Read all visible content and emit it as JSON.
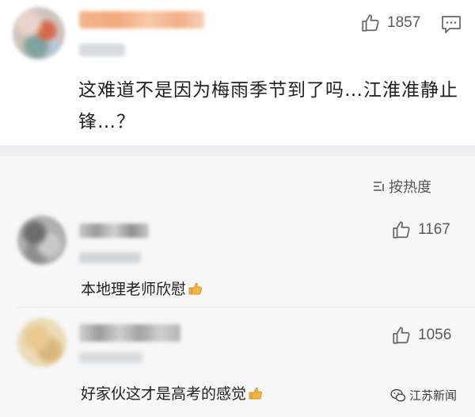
{
  "top_comment": {
    "likes": "1857",
    "text": "这难道不是因为梅雨季节到了吗…江淮准静止锋…？"
  },
  "sort": {
    "label": "按热度"
  },
  "replies": [
    {
      "likes": "1167",
      "text": "本地理老师欣慰"
    },
    {
      "likes": "1056",
      "text": "好家伙这才是高考的感觉"
    }
  ],
  "watermark": {
    "text": "江苏新闻"
  },
  "icons": {
    "like": "thumbs-up-outline-icon",
    "reply": "chat-bubble-icon",
    "sort": "sort-lines-icon",
    "emoji": "thumbs-up-emoji-icon",
    "watermark": "wechat-logo-icon"
  }
}
